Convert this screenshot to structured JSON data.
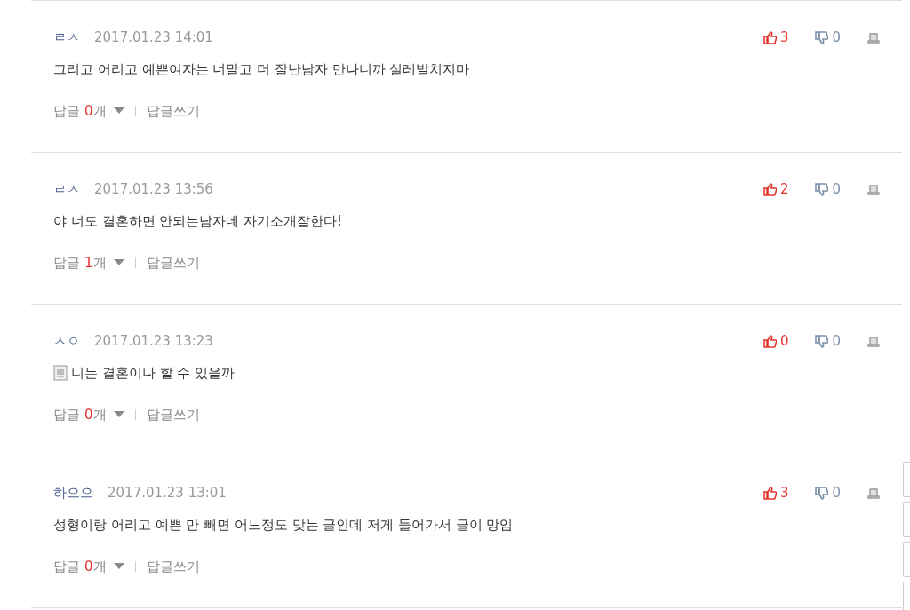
{
  "comments": [
    {
      "author": "ㄹㅅ",
      "date": "2017.01.23 14:01",
      "likes": "3",
      "dislikes": "0",
      "attachment": false,
      "text": "그리고 어리고 예쁜여자는 너말고 더 잘난남자 만나니까 설레발치지마",
      "reply_label": "답글",
      "reply_count": "0",
      "reply_unit": "개",
      "write_label": "답글쓰기"
    },
    {
      "author": "ㄹㅅ",
      "date": "2017.01.23 13:56",
      "likes": "2",
      "dislikes": "0",
      "attachment": false,
      "text": "야 너도 결혼하면 안되는남자네 자기소개잘한다!",
      "reply_label": "답글",
      "reply_count": "1",
      "reply_unit": "개",
      "write_label": "답글쓰기"
    },
    {
      "author": "ㅅㅇ",
      "date": "2017.01.23 13:23",
      "likes": "0",
      "dislikes": "0",
      "attachment": true,
      "text": "니는 결혼이나 할 수 있을까",
      "reply_label": "답글",
      "reply_count": "0",
      "reply_unit": "개",
      "write_label": "답글쓰기"
    },
    {
      "author": "하으으",
      "date": "2017.01.23 13:01",
      "likes": "3",
      "dislikes": "0",
      "attachment": false,
      "text": "성형이랑 어리고 예쁜 만 빼면 어느정도 맞는 글인데 저게 들어가서 글이 망임",
      "reply_label": "답글",
      "reply_count": "0",
      "reply_unit": "개",
      "write_label": "답글쓰기"
    }
  ]
}
